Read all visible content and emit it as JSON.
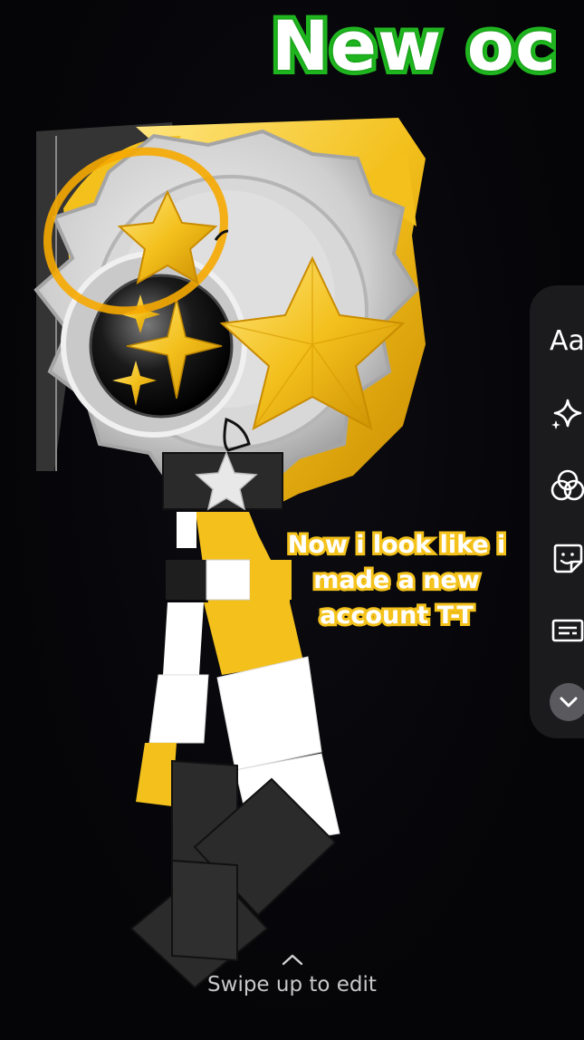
{
  "story": {
    "title": "New oc",
    "caption_lines": [
      "Now i look like i",
      "made a new",
      "account T-T"
    ]
  },
  "toolbar": {
    "text_tool_label": "Aa",
    "tools": [
      {
        "name": "text-tool",
        "icon": "text-icon"
      },
      {
        "name": "effects-tool",
        "icon": "sparkle-icon"
      },
      {
        "name": "filters-tool",
        "icon": "filter-circles-icon"
      },
      {
        "name": "sticker-tool",
        "icon": "sticker-icon"
      },
      {
        "name": "caption-tool",
        "icon": "caption-icon"
      },
      {
        "name": "more-tool",
        "icon": "chevron-down-icon"
      }
    ]
  },
  "bottom": {
    "swipe_label": "Swipe up to edit",
    "icon": "chevron-up-icon"
  },
  "colors": {
    "background": "#050508",
    "title_outline": "#1fb51f",
    "caption_outline": "#f4c21a",
    "gold": "#f3c01c",
    "toolbar_bg": "#1b1b1e"
  }
}
